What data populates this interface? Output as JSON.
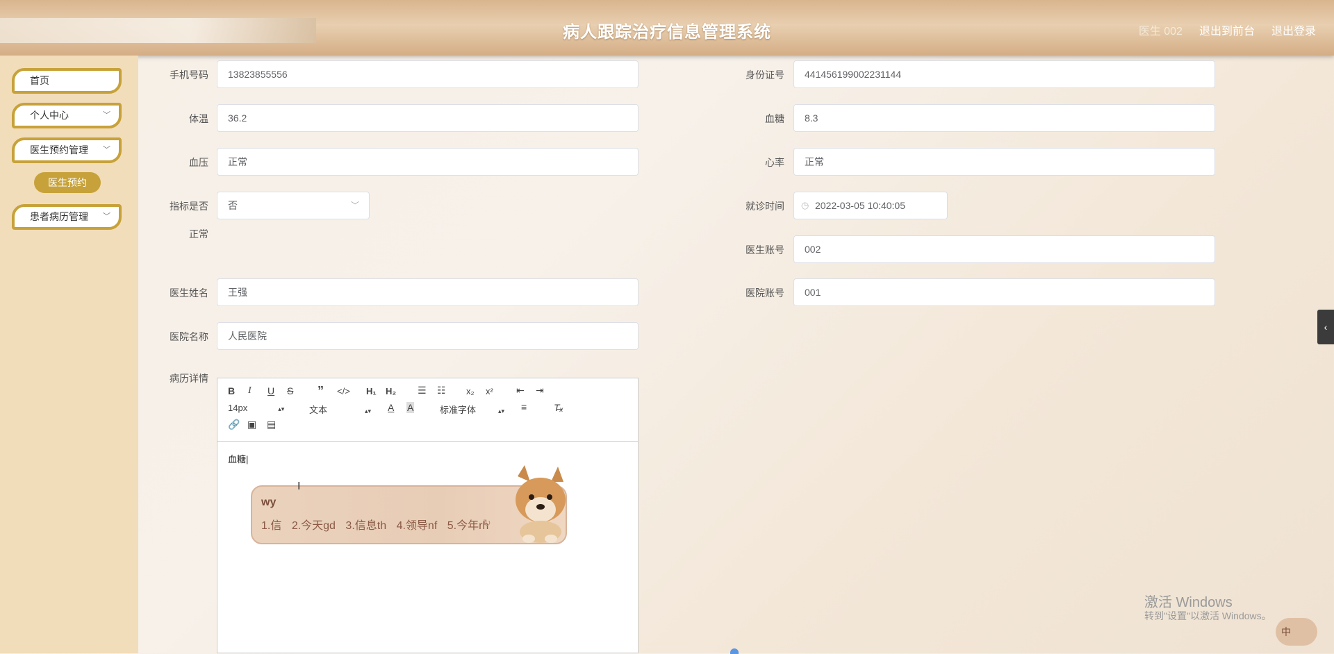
{
  "header": {
    "title": "病人跟踪治疗信息管理系统",
    "user": "医生 002",
    "front_link": "退出到前台",
    "logout": "退出登录"
  },
  "sidebar": {
    "items": [
      {
        "label": "首页"
      },
      {
        "label": "个人中心"
      },
      {
        "label": "医生预约管理"
      },
      {
        "label": "患者病历管理"
      }
    ],
    "sub_item": "医生预约"
  },
  "form": {
    "phone": {
      "label": "手机号码",
      "value": "13823855556"
    },
    "idcard": {
      "label": "身份证号",
      "value": "441456199002231144"
    },
    "temp": {
      "label": "体温",
      "value": "36.2"
    },
    "sugar": {
      "label": "血糖",
      "value": "8.3"
    },
    "bp": {
      "label": "血压",
      "value": "正常"
    },
    "hr": {
      "label": "心率",
      "value": "正常"
    },
    "normal": {
      "label1": "指标是否",
      "label2": "正常",
      "value": "否"
    },
    "visit_time": {
      "label": "就诊时间",
      "value": "2022-03-05 10:40:05"
    },
    "doctor_account": {
      "label": "医生账号",
      "value": "002"
    },
    "doctor_name": {
      "label": "医生姓名",
      "value": "王强"
    },
    "hospital_account": {
      "label": "医院账号",
      "value": "001"
    },
    "hospital_name": {
      "label": "医院名称",
      "value": "人民医院"
    },
    "record": {
      "label": "病历详情"
    }
  },
  "editor": {
    "size": "14px",
    "paragraph": "文本",
    "font": "标准字体",
    "content": "血糖"
  },
  "ime": {
    "typed": "wy",
    "candidates": [
      "1.信",
      "2.今天gd",
      "3.信息th",
      "4.领导nf",
      "5.今年rh"
    ],
    "corner": "中"
  },
  "watermark": {
    "line1": "激活 Windows",
    "line2": "转到\"设置\"以激活 Windows。"
  }
}
